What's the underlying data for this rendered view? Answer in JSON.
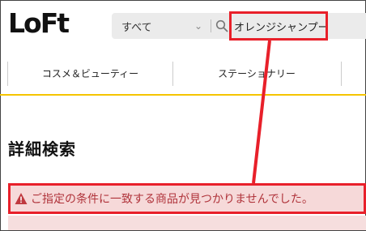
{
  "header": {
    "logo_text": "LoFt",
    "search": {
      "category_label": "すべて",
      "query_value": "オレンジシャンプー"
    }
  },
  "nav": {
    "items": [
      {
        "label": "コスメ＆ビューティー"
      },
      {
        "label": "ステーショナリー"
      }
    ]
  },
  "main": {
    "page_title": "詳細検索",
    "alert": {
      "message": "ご指定の条件に一致する商品が見つかりませんでした。"
    }
  },
  "colors": {
    "accent_yellow": "#f5c400",
    "highlight_red": "#e8202a",
    "alert_text": "#b0343b",
    "alert_bg": "#f6d9d9"
  },
  "icons": {
    "search": "search-icon",
    "chevron": "chevron-down-icon",
    "warning": "warning-icon"
  }
}
